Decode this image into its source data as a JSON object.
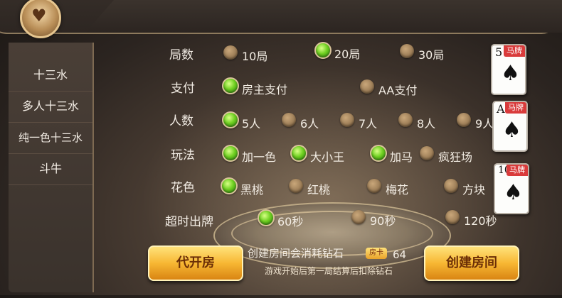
{
  "sidebar": {
    "items": [
      {
        "label": "十三水"
      },
      {
        "label": "多人十三水"
      },
      {
        "label": "纯一色十三水"
      },
      {
        "label": "斗牛"
      }
    ]
  },
  "settings": {
    "rounds": {
      "label": "局数",
      "options": [
        "10局",
        "20局",
        "30局"
      ],
      "selected": "20局"
    },
    "payment": {
      "label": "支付",
      "options": [
        "房主支付",
        "AA支付"
      ],
      "selected": "房主支付"
    },
    "players": {
      "label": "人数",
      "options": [
        "5人",
        "6人",
        "7人",
        "8人",
        "9人"
      ],
      "selected": "5人"
    },
    "gameplay": {
      "label": "玩法",
      "options": [
        "加一色",
        "大小王",
        "加马",
        "疯狂场"
      ],
      "selected": [
        "加一色",
        "大小王",
        "加马"
      ]
    },
    "suit": {
      "label": "花色",
      "options": [
        "黑桃",
        "红桃",
        "梅花",
        "方块"
      ],
      "selected": "黑桃"
    },
    "timeout": {
      "label": "超时出牌",
      "options": [
        "60秒",
        "90秒",
        "120秒"
      ],
      "selected": "60秒"
    }
  },
  "horse_cards": [
    {
      "rank": "5",
      "suit": "♠",
      "tag": "马牌"
    },
    {
      "rank": "A",
      "suit": "♠",
      "tag": "马牌"
    },
    {
      "rank": "10",
      "suit": "♠",
      "tag": "马牌"
    }
  ],
  "footer": {
    "proxy_button": "代开房",
    "create_button": "创建房间",
    "cost_text": "创建房间会消耗钻石",
    "badge_text": "房卡",
    "cost_value": "64",
    "note": "游戏开始后第一局结算后扣除钻石"
  },
  "colors": {
    "accent": "#f7b733",
    "selected_radio": "#6fd021"
  }
}
